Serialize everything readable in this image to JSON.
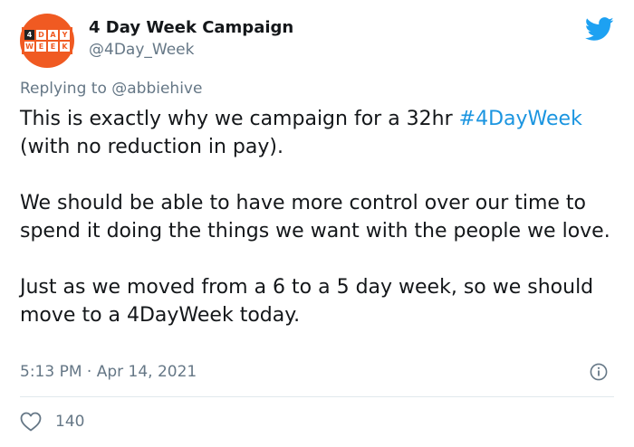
{
  "colors": {
    "brand_orange": "#f05a22",
    "link_blue": "#1b95e0",
    "twitter_blue": "#1da1f2",
    "muted": "#657786",
    "text": "#14171a"
  },
  "author": {
    "avatar_icon": "4-day-week-logo",
    "logo_row1": [
      "4",
      "D",
      "A",
      "Y"
    ],
    "logo_row2": [
      "W",
      "E",
      "E",
      "K"
    ],
    "name": "4 Day Week Campaign",
    "handle": "@4Day_Week"
  },
  "header": {
    "brand_icon": "twitter-bird-icon"
  },
  "reply": {
    "prefix": "Replying to",
    "mention": "@abbiehive"
  },
  "tweet": {
    "p1_before": "This is exactly why we campaign for a 32hr",
    "hashtag": "#4DayWeek",
    "p1_after": "(with no reduction in pay).",
    "p2": "We should be able to have more control over our time to spend it doing the things we want with the people we love.",
    "p3": "Just as we moved from a 6 to a 5 day week, so we should move to a 4DayWeek today."
  },
  "meta": {
    "timestamp": "5:13 PM · Apr 14, 2021",
    "info_icon": "info-icon"
  },
  "actions": {
    "like_icon": "heart-icon",
    "like_count": "140"
  }
}
